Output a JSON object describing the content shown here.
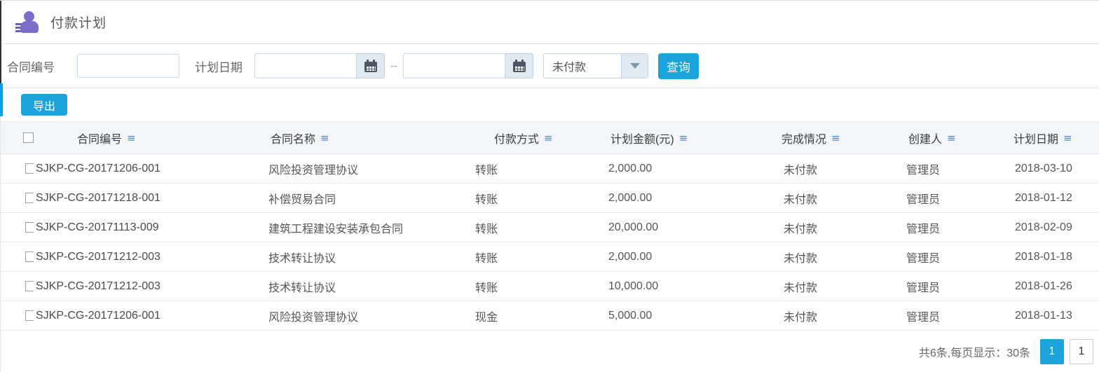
{
  "header": {
    "title": "付款计划"
  },
  "filters": {
    "contract_no_label": "合同编号",
    "contract_no_value": "",
    "plan_date_label": "计划日期",
    "date_from_value": "",
    "date_to_value": "",
    "date_separator": "--",
    "status_selected": "未付款",
    "search_button": "查询"
  },
  "toolbar": {
    "export_button": "导出"
  },
  "table": {
    "columns": [
      "合同编号",
      "合同名称",
      "付款方式",
      "计划金额(元)",
      "完成情况",
      "创建人",
      "计划日期"
    ],
    "rows": [
      {
        "contract_no": "SJKP-CG-20171206-001",
        "contract_name": "风险投资管理协议",
        "payment_method": "转账",
        "planned_amount": "2,000.00",
        "status": "未付款",
        "creator": "管理员",
        "plan_date": "2018-03-10"
      },
      {
        "contract_no": "SJKP-CG-20171218-001",
        "contract_name": "补偿贸易合同",
        "payment_method": "转账",
        "planned_amount": "2,000.00",
        "status": "未付款",
        "creator": "管理员",
        "plan_date": "2018-01-12"
      },
      {
        "contract_no": "SJKP-CG-20171113-009",
        "contract_name": "建筑工程建设安装承包合同",
        "payment_method": "转账",
        "planned_amount": "20,000.00",
        "status": "未付款",
        "creator": "管理员",
        "plan_date": "2018-02-09"
      },
      {
        "contract_no": "SJKP-CG-20171212-003",
        "contract_name": "技术转让协议",
        "payment_method": "转账",
        "planned_amount": "2,000.00",
        "status": "未付款",
        "creator": "管理员",
        "plan_date": "2018-01-18"
      },
      {
        "contract_no": "SJKP-CG-20171212-003",
        "contract_name": "技术转让协议",
        "payment_method": "转账",
        "planned_amount": "10,000.00",
        "status": "未付款",
        "creator": "管理员",
        "plan_date": "2018-01-26"
      },
      {
        "contract_no": "SJKP-CG-20171206-001",
        "contract_name": "风险投资管理协议",
        "payment_method": "现金",
        "planned_amount": "5,000.00",
        "status": "未付款",
        "creator": "管理员",
        "plan_date": "2018-01-13"
      }
    ]
  },
  "pagination": {
    "summary": "共6条,每页显示：30条",
    "current_page": "1",
    "page_box": "1"
  },
  "icons": {
    "sort_glyph": "≡"
  },
  "colors": {
    "accent_blue": "#1aa3dd",
    "edge_blue": "#00a2e9",
    "icon_purple": "#7b6ec8",
    "header_bg": "#f3f6f9",
    "sort_icon_blue": "#4a86c8"
  }
}
